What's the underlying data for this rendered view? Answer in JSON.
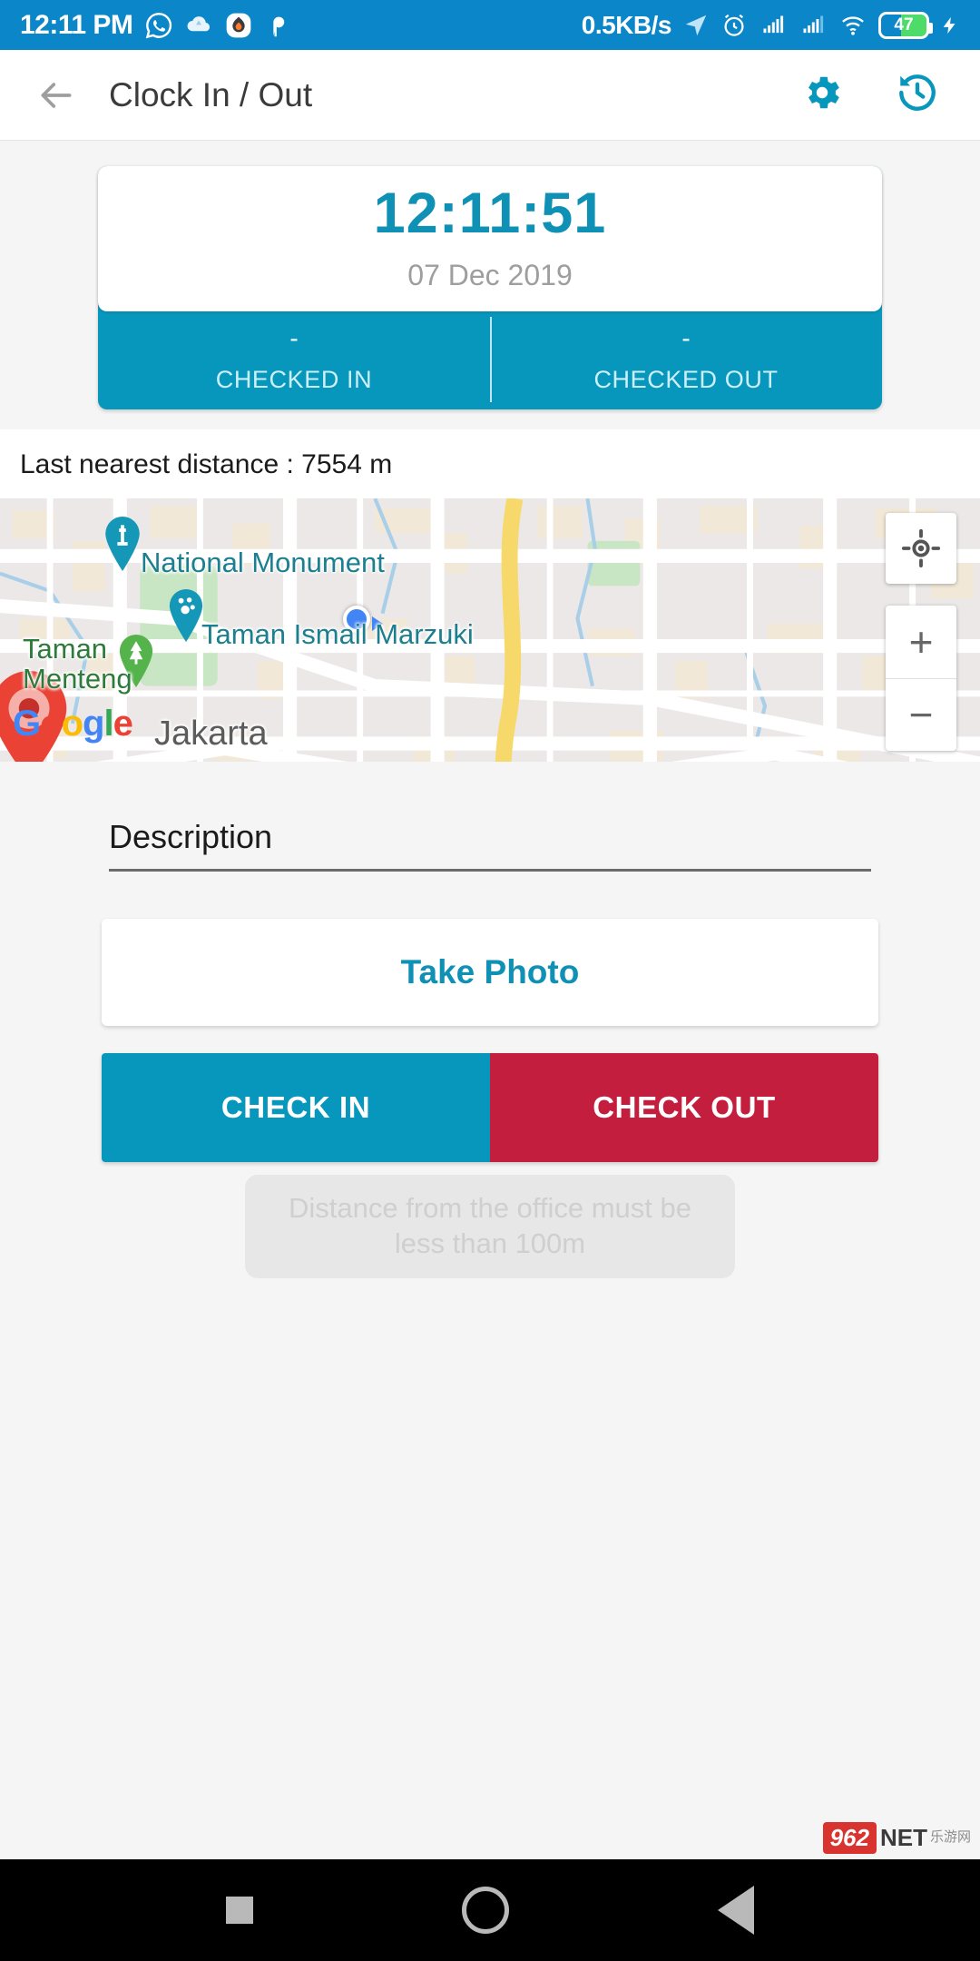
{
  "statusbar": {
    "time": "12:11 PM",
    "network_speed": "0.5KB/s",
    "battery_level": "47",
    "icons": [
      "whatsapp-icon",
      "cloud-icon",
      "app-icon",
      "pinterest-icon",
      "location-arrow-icon",
      "alarm-icon",
      "signal-bars-1-icon",
      "signal-bars-2-icon",
      "wifi-icon",
      "battery-icon",
      "charging-bolt-icon"
    ],
    "bar_color": "#0b87c9"
  },
  "appbar": {
    "title": "Clock In / Out",
    "back_icon": "back-arrow-icon",
    "settings_icon": "gear-icon",
    "history_icon": "history-icon",
    "accent": "#0897bc"
  },
  "clock": {
    "time": "12:11:51",
    "date": "07 Dec 2019",
    "checked_in_value": "-",
    "checked_in_label": "CHECKED IN",
    "checked_out_value": "-",
    "checked_out_label": "CHECKED OUT",
    "band_color": "#0897bc",
    "time_color": "#0f90b5"
  },
  "distance": {
    "text": "Last nearest distance  : 7554 m"
  },
  "map": {
    "labels": {
      "national_monument": "National Monument",
      "taman_ismail": "Taman Ismail Marzuki",
      "taman_menteng_l1": "Taman",
      "taman_menteng_l2": "Menteng",
      "jakarta": "Jakarta"
    },
    "attribution": "Google",
    "controls": {
      "locate_icon": "my-location-icon",
      "zoom_in": "+",
      "zoom_out": "−"
    },
    "markers": [
      "monument-pin",
      "theater-pin",
      "park-pin",
      "user-location-dot",
      "red-place-marker"
    ]
  },
  "form": {
    "description_placeholder": "Description",
    "description_value": "",
    "take_photo_label": "Take Photo",
    "check_in_label": "CHECK IN",
    "check_out_label": "CHECK OUT",
    "check_in_color": "#0897bc",
    "check_out_color": "#c41e3f",
    "toast_message": "Distance from the office must be less than 100m"
  },
  "navbar": {
    "recent_icon": "square-recent-icon",
    "home_icon": "circle-home-icon",
    "back_icon": "triangle-back-icon"
  },
  "watermark": {
    "num": "962",
    "net": "NET",
    "cn_l1": "乐游网"
  }
}
